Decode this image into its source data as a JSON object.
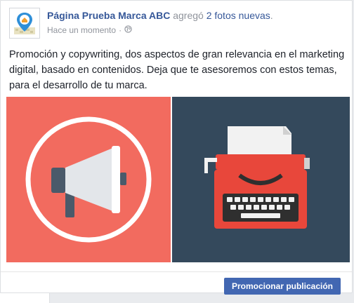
{
  "post": {
    "page_name": "Página Prueba Marca ABC",
    "action_text": "agregó",
    "photos_link": "2 fotos nuevas",
    "action_suffix": ".",
    "timestamp": "Hace un momento",
    "separator": "·",
    "audience_icon": "globe-icon",
    "body": "Promoción y copywriting, dos aspectos de gran relevancia en el marketing digital, basado en contenidos. Deja que te asesoremos con estos temas, para el desarrollo de tu marca."
  },
  "photos": [
    {
      "icon": "megaphone-icon",
      "background": "#f26b5f"
    },
    {
      "icon": "typewriter-icon",
      "background": "#34495c"
    }
  ],
  "footer": {
    "promote_label": "Promocionar publicación"
  },
  "colors": {
    "link": "#365899",
    "button": "#4267b2",
    "coral": "#f26b5f",
    "slate": "#34495c",
    "red": "#e8473b"
  }
}
